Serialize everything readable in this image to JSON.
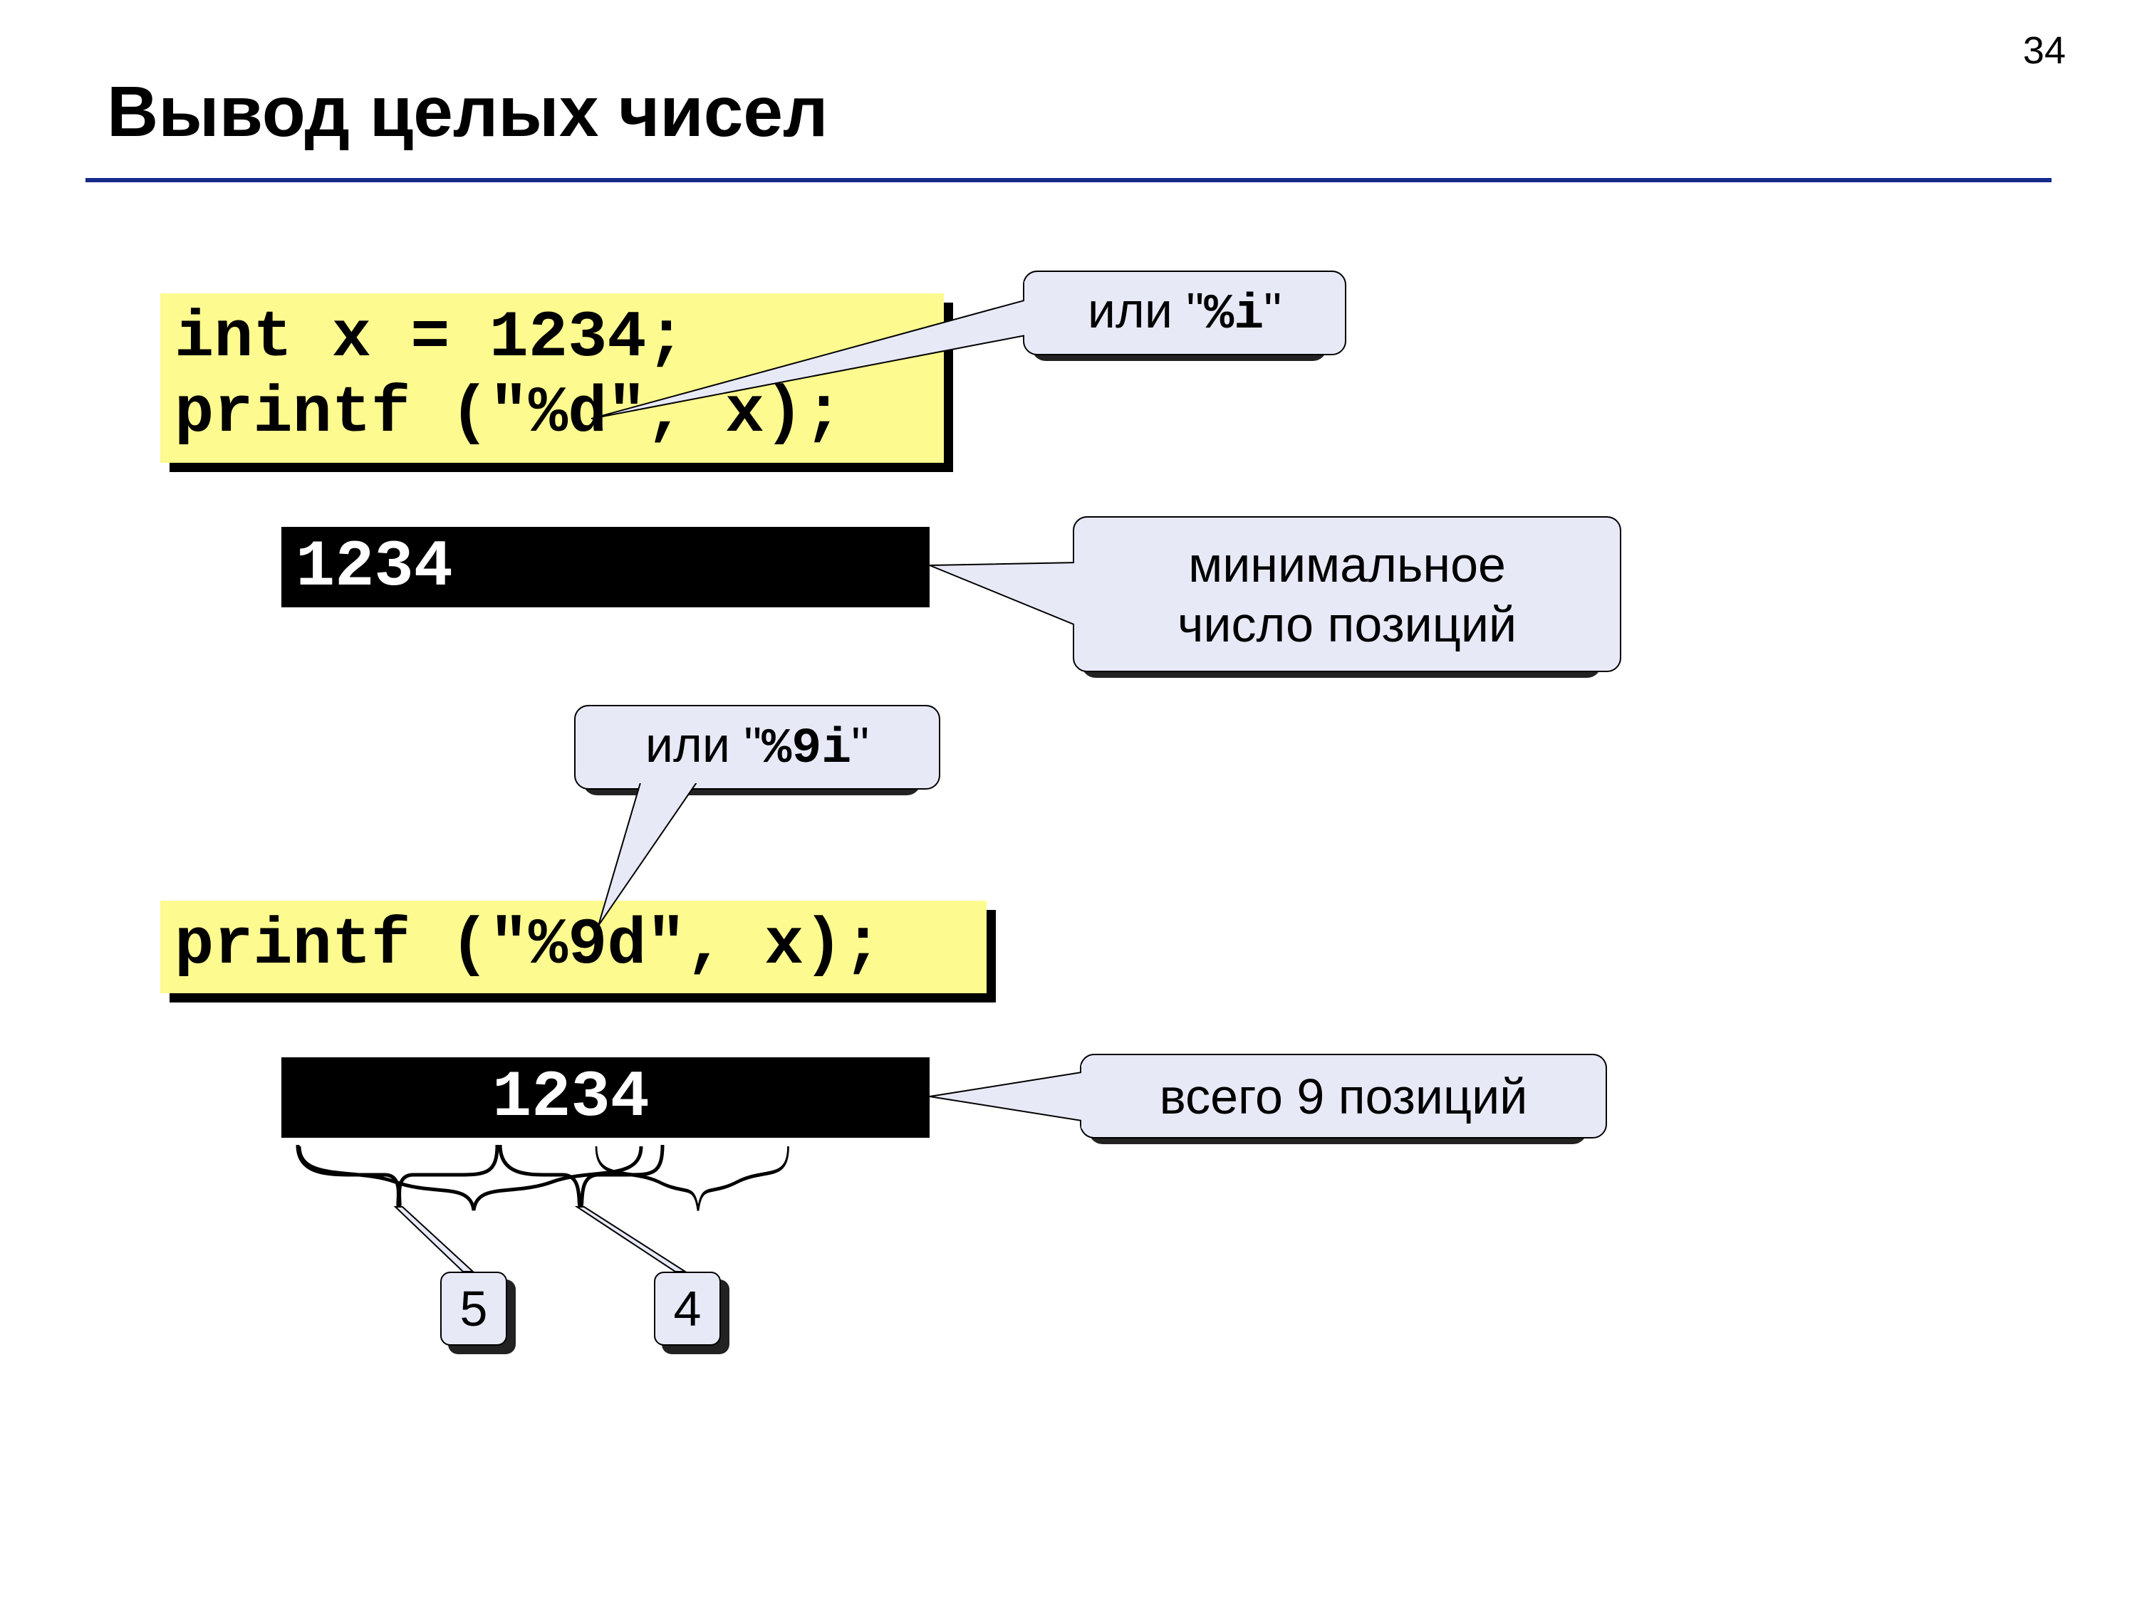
{
  "page_number": "34",
  "title": "Вывод целых чисел",
  "code1_line1": "int x = 1234;",
  "code1_line2": "printf (\"%d\", x);",
  "output1": "1234",
  "callout1_prefix": "или \"",
  "callout1_bold": "%i",
  "callout1_suffix": "\"",
  "callout2_line1": "минимальное",
  "callout2_line2": "число позиций",
  "callout3_prefix": "или \"",
  "callout3_bold": "%9i",
  "callout3_suffix": "\"",
  "code2": "printf (\"%9d\", x);",
  "output2": "     1234",
  "callout4": "всего 9 позиций",
  "brace_left": "5",
  "brace_right": "4"
}
